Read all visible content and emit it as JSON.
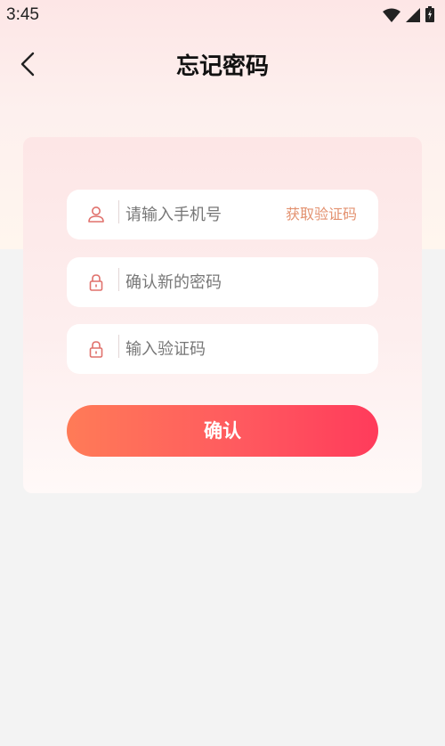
{
  "status_bar": {
    "time": "3:45"
  },
  "nav": {
    "title": "忘记密码"
  },
  "form": {
    "phone_placeholder": "请输入手机号",
    "get_code_label": "获取验证码",
    "new_password_placeholder": "确认新的密码",
    "verify_code_placeholder": "输入验证码",
    "confirm_label": "确认"
  },
  "colors": {
    "accent_start": "#ff7b57",
    "accent_end": "#ff3b5b",
    "icon": "#e0716c",
    "link": "#e3916f"
  },
  "icons": {
    "back": "chevron-left-icon",
    "phone_field": "user-icon",
    "password_field": "lock-icon",
    "code_field": "lock-icon"
  }
}
